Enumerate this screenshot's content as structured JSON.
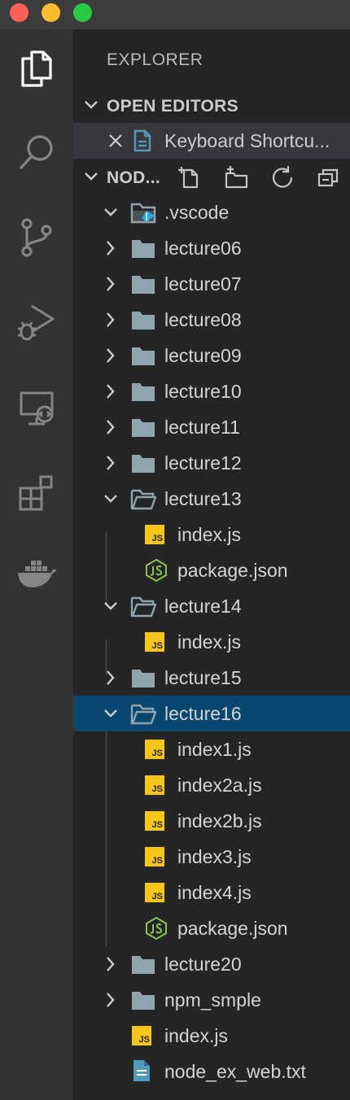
{
  "window": {
    "controls": [
      "close",
      "minimize",
      "maximize"
    ]
  },
  "activity_bar": {
    "items": [
      "files-icon",
      "search-icon",
      "source-control-icon",
      "run-debug-icon",
      "remote-explorer-icon",
      "extensions-icon",
      "docker-icon"
    ]
  },
  "sidebar": {
    "title": "EXPLORER",
    "open_editors": {
      "label": "OPEN EDITORS",
      "items": [
        {
          "name": "Keyboard Shortcu...",
          "icon": "keyboard-shortcuts-file-icon"
        }
      ]
    },
    "project": {
      "label": "NOD...",
      "actions": [
        "new-file-icon",
        "new-folder-icon",
        "refresh-icon",
        "collapse-all-icon"
      ],
      "tree": [
        {
          "name": ".vscode",
          "type": "folder",
          "expanded": true
        },
        {
          "name": "lecture06",
          "type": "folder",
          "expanded": false
        },
        {
          "name": "lecture07",
          "type": "folder",
          "expanded": false
        },
        {
          "name": "lecture08",
          "type": "folder",
          "expanded": false
        },
        {
          "name": "lecture09",
          "type": "folder",
          "expanded": false
        },
        {
          "name": "lecture10",
          "type": "folder",
          "expanded": false
        },
        {
          "name": "lecture11",
          "type": "folder",
          "expanded": false
        },
        {
          "name": "lecture12",
          "type": "folder",
          "expanded": false
        },
        {
          "name": "lecture13",
          "type": "folder",
          "expanded": true
        },
        {
          "name": "index.js",
          "type": "js"
        },
        {
          "name": "package.json",
          "type": "json"
        },
        {
          "name": "lecture14",
          "type": "folder",
          "expanded": true
        },
        {
          "name": "index.js",
          "type": "js"
        },
        {
          "name": "lecture15",
          "type": "folder",
          "expanded": false
        },
        {
          "name": "lecture16",
          "type": "folder",
          "expanded": true,
          "selected": true
        },
        {
          "name": "index1.js",
          "type": "js"
        },
        {
          "name": "index2a.js",
          "type": "js"
        },
        {
          "name": "index2b.js",
          "type": "js"
        },
        {
          "name": "index3.js",
          "type": "js"
        },
        {
          "name": "index4.js",
          "type": "js"
        },
        {
          "name": "package.json",
          "type": "json"
        },
        {
          "name": "lecture20",
          "type": "folder",
          "expanded": false
        },
        {
          "name": "npm_smple",
          "type": "folder",
          "expanded": false
        },
        {
          "name": "index.js",
          "type": "js"
        },
        {
          "name": "node_ex_web.txt",
          "type": "txt"
        }
      ]
    }
  },
  "colors": {
    "selection": "#094771",
    "js_badge": "#f5c518",
    "json_icon": "#8bc34a",
    "folder": "#90a4ae",
    "file_blue": "#519aba"
  }
}
